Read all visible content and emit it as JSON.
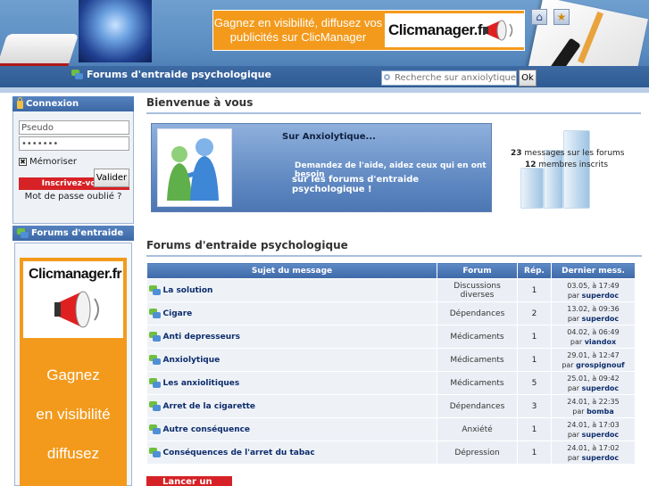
{
  "header": {
    "banner_text": "Gagnez en visibilité, diffusez vos publicités sur ClicManager",
    "banner_logo": "Clicmanager.fr",
    "home_icon": "⌂",
    "fav_icon": "★",
    "nav_label": "Forums d'entraide psychologique",
    "search_placeholder": "Recherche sur anxiolytique...",
    "search_button": "Ok"
  },
  "sidebar": {
    "login_title": "Connexion",
    "pseudo_value": "Pseudo",
    "password_value": "•••••••",
    "remember_label": "Mémoriser",
    "validate_label": "Valider",
    "register_label": "Inscrivez-vous",
    "forgot_label": "Mot de passe oublié ?",
    "forums_title": "Forums d'entraide",
    "ad_logo": "Clicmanager.fr",
    "ad_line1": "Gagnez",
    "ad_line2": "en visibilité",
    "ad_line3": "diffusez"
  },
  "main": {
    "welcome_title": "Bienvenue à vous",
    "welcome_heading": "Sur Anxiolytique...",
    "welcome_line1": "Demandez de l'aide, aidez ceux qui en ont besoin",
    "welcome_line2": "sur les forums d'entraide psychologique !",
    "stats": {
      "messages_count": "23",
      "messages_label": "messages sur les forums",
      "members_count": "12",
      "members_label": "membres inscrits"
    },
    "forum_title": "Forums d'entraide psychologique",
    "columns": [
      "Sujet du message",
      "Forum",
      "Rép.",
      "Dernier mess."
    ],
    "rows": [
      {
        "subject": "La solution",
        "forum": "Discussions diverses",
        "replies": "1",
        "date": "03.05, à 17:49",
        "by": "par",
        "user": "superdoc"
      },
      {
        "subject": "Cigare",
        "forum": "Dépendances",
        "replies": "2",
        "date": "13.02, à 09:36",
        "by": "par",
        "user": "superdoc"
      },
      {
        "subject": "Anti depresseurs",
        "forum": "Médicaments",
        "replies": "1",
        "date": "04.02, à 06:49",
        "by": "par",
        "user": "viandox"
      },
      {
        "subject": "Anxiolytique",
        "forum": "Médicaments",
        "replies": "1",
        "date": "29.01, à 12:47",
        "by": "par",
        "user": "grospignouf"
      },
      {
        "subject": "Les anxiolitiques",
        "forum": "Médicaments",
        "replies": "5",
        "date": "25.01, à 09:42",
        "by": "par",
        "user": "superdoc"
      },
      {
        "subject": "Arret de la cigarette",
        "forum": "Dépendances",
        "replies": "3",
        "date": "24.01, à 22:35",
        "by": "par",
        "user": "bomba"
      },
      {
        "subject": "Autre conséquence",
        "forum": "Anxiété",
        "replies": "1",
        "date": "24.01, à 17:03",
        "by": "par",
        "user": "superdoc"
      },
      {
        "subject": "Conséquences de l'arret du tabac",
        "forum": "Dépression",
        "replies": "1",
        "date": "24.01, à 17:02",
        "by": "par",
        "user": "superdoc"
      }
    ],
    "new_topic_label": "Lancer un sujet"
  }
}
